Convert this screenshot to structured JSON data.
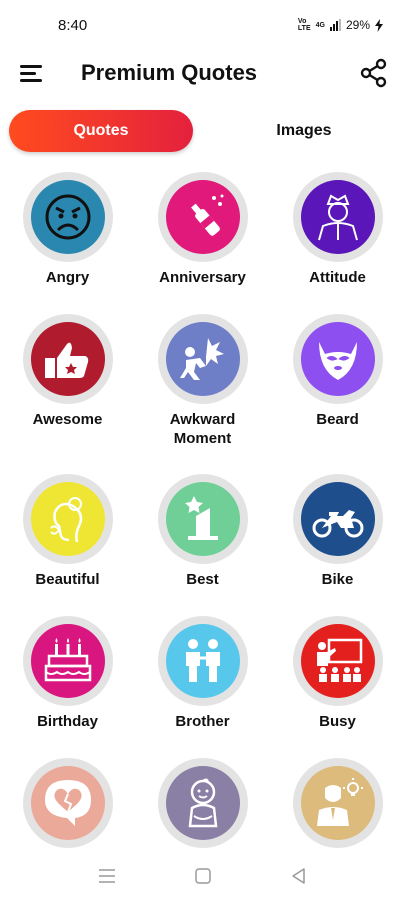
{
  "status": {
    "time": "8:40",
    "network": [
      "Vo",
      "LTE"
    ],
    "network2": [
      "4G"
    ],
    "battery": "29%",
    "icons": [
      "volte-icon",
      "signal-icon",
      "charging-bolt-icon"
    ]
  },
  "app_bar": {
    "title": "Premium Quotes",
    "menu_icon": "hamburger-menu-icon",
    "share_icon": "share-icon"
  },
  "tabs": {
    "quotes": "Quotes",
    "images": "Images",
    "active_gradient": [
      "#ff4b1f",
      "#e4213d"
    ]
  },
  "categories": [
    {
      "label": "Angry",
      "color": "#2a88b0",
      "icon": "angry-face-icon"
    },
    {
      "label": "Anniversary",
      "color": "#e0197a",
      "icon": "champagne-icon"
    },
    {
      "label": "Attitude",
      "color": "#5a16b8",
      "icon": "attitude-person-icon"
    },
    {
      "label": "Awesome",
      "color": "#b01c2e",
      "icon": "thumbs-up-icon"
    },
    {
      "label": "Awkward Moment",
      "color": "#6f7fc7",
      "icon": "awkward-fall-icon"
    },
    {
      "label": "Beard",
      "color": "#8d4ff0",
      "icon": "beard-icon"
    },
    {
      "label": "Beautiful",
      "color": "#eee633",
      "icon": "beautiful-face-icon"
    },
    {
      "label": "Best",
      "color": "#6fcf97",
      "icon": "star-trophy-icon"
    },
    {
      "label": "Bike",
      "color": "#1f4e8c",
      "icon": "motorbike-icon"
    },
    {
      "label": "Birthday",
      "color": "#d9157f",
      "icon": "birthday-cake-icon"
    },
    {
      "label": "Brother",
      "color": "#58c7ec",
      "icon": "brothers-icon"
    },
    {
      "label": "Busy",
      "color": "#e4201f",
      "icon": "busy-presentation-icon"
    },
    {
      "label": "",
      "color": "#eba999",
      "icon": "broken-heart-icon"
    },
    {
      "label": "",
      "color": "#8a7fa4",
      "icon": "baby-icon"
    },
    {
      "label": "",
      "color": "#dcbb7c",
      "icon": "businessman-idea-icon"
    }
  ],
  "nav": {
    "recents_icon": "recents-icon",
    "home_icon": "home-icon",
    "back_icon": "back-icon"
  }
}
